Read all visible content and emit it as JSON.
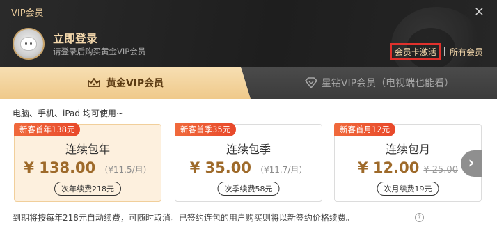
{
  "window": {
    "title": "VIP会员",
    "close_icon": "×"
  },
  "user": {
    "login_title": "立即登录",
    "login_subtitle": "请登录后购买黄金VIP会员"
  },
  "header_links": {
    "card_activate": "会员卡激活",
    "all_members": "所有会员"
  },
  "tabs": [
    {
      "label": "黄金VIP会员",
      "icon": "crown-icon",
      "active": true
    },
    {
      "label": "星钻VIP会员（电视端也能看）",
      "icon": "diamond-icon",
      "active": false
    }
  ],
  "device_note": "电脑、手机、iPad 均可使用~",
  "packages": [
    {
      "badge": "新客首年138元",
      "name": "连续包年",
      "price": "¥ 138.00",
      "unit": "（¥11.5/月）",
      "strike": "",
      "renew": "次年续费218元",
      "selected": true
    },
    {
      "badge": "新客首季35元",
      "name": "连续包季",
      "price": "¥ 35.00",
      "unit": "（¥11.7/月）",
      "strike": "",
      "renew": "次季续费58元",
      "selected": false
    },
    {
      "badge": "新客首月12元",
      "name": "连续包月",
      "price": "¥ 12.00",
      "unit": "",
      "strike": "¥ 25.00",
      "renew": "次月续费19元",
      "selected": false
    }
  ],
  "next_arrow": "›",
  "footer_note": "到期将按每年218元自动续费，可随时取消。已签约连包的用户购买则将以新签约价格续费。",
  "help_icon": "?",
  "colors": {
    "accent_gold": "#f3d7ab",
    "price": "#9e6a2a",
    "badge": "#e8482a",
    "highlight_border": "#e0312c"
  }
}
